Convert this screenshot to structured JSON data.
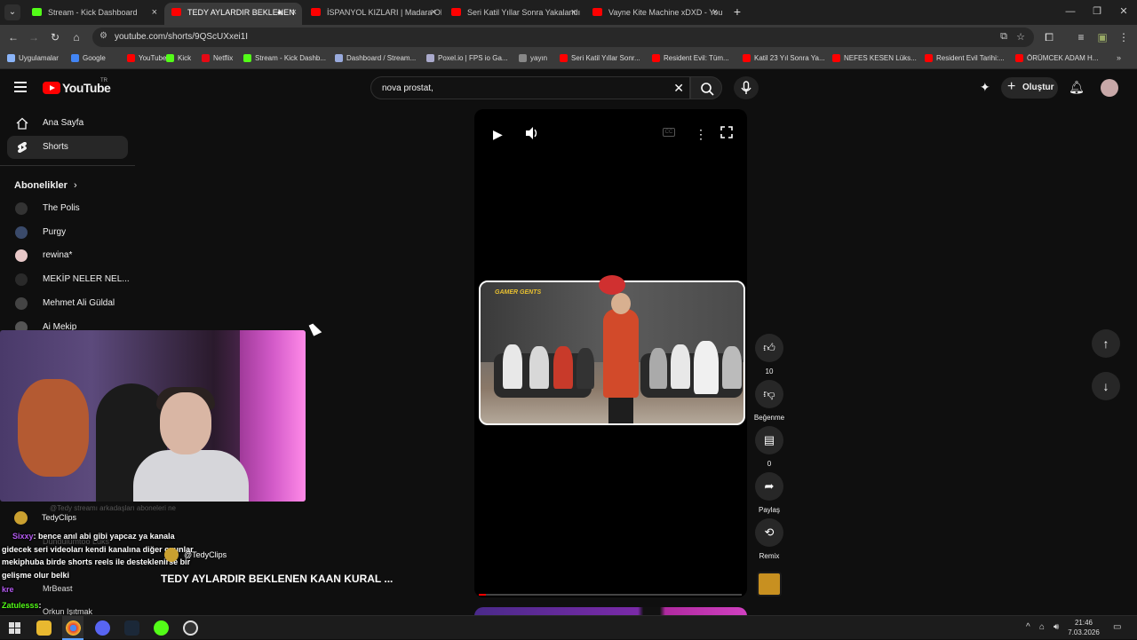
{
  "browser": {
    "tabs": [
      {
        "title": "Stream - Kick Dashboard",
        "active": false,
        "favicon_color": "#53fc18"
      },
      {
        "title": "TEDY AYLARDIR BEKLENEN",
        "active": true,
        "favicon_color": "#ff0000"
      },
      {
        "title": "İSPANYOL KIZLARI | Madara Ol",
        "active": false,
        "favicon_color": "#ff0000"
      },
      {
        "title": "Seri Katil Yıllar Sonra Yakalandı",
        "active": false,
        "favicon_color": "#ff0000"
      },
      {
        "title": "Vayne Kite Machine xDXD - You",
        "active": false,
        "favicon_color": "#ff0000"
      }
    ],
    "url": "youtube.com/shorts/9QScUXxei1I",
    "bookmarks": [
      {
        "label": "Uygulamalar",
        "color": "#8ab4f8"
      },
      {
        "label": "Google",
        "color": "#4285f4"
      },
      {
        "label": "YouTube",
        "color": "#ff0000"
      },
      {
        "label": "Kick",
        "color": "#53fc18"
      },
      {
        "label": "Netflix",
        "color": "#e50914"
      },
      {
        "label": "Stream - Kick Dashb...",
        "color": "#53fc18"
      },
      {
        "label": "Dashboard / Stream...",
        "color": "#9ad"
      },
      {
        "label": "Poxel.io | FPS io Ga...",
        "color": "#aac"
      },
      {
        "label": "yayın",
        "color": "#888"
      },
      {
        "label": "Seri Katil Yıllar Sonr...",
        "color": "#ff0000"
      },
      {
        "label": "Resident Evil: Tüm...",
        "color": "#ff0000"
      },
      {
        "label": "Katil 23 Yıl Sonra Ya...",
        "color": "#ff0000"
      },
      {
        "label": "NEFES KESEN Lüks...",
        "color": "#ff0000"
      },
      {
        "label": "Resident Evil Tarihi:...",
        "color": "#ff0000"
      },
      {
        "label": "ÖRÜMCEK ADAM H...",
        "color": "#ff0000"
      }
    ]
  },
  "youtube": {
    "logo_text": "YouTube",
    "country": "TR",
    "search_query": "nova prostat,",
    "create_label": "Oluştur",
    "sidebar": {
      "home": "Ana Sayfa",
      "shorts": "Shorts",
      "subscriptions_header": "Abonelikler",
      "subscriptions": [
        {
          "name": "The Polis",
          "color": "#333"
        },
        {
          "name": "Purgy",
          "color": "#3a4a6a"
        },
        {
          "name": "rewina*",
          "color": "#e8c8c8"
        },
        {
          "name": "MEKİP NELER NEL...",
          "color": "#2a2a2a"
        },
        {
          "name": "Mehmet Ali Güldal",
          "color": "#444"
        },
        {
          "name": "Ai Mekip",
          "color": "#555"
        }
      ]
    },
    "short": {
      "title": "TEDY AYLARDIR BEKLENEN KAAN KURAL ...",
      "channel": "@TedyClips",
      "video_logo": "GAMER GENTS",
      "likes": "10",
      "dislike_label": "Beğenme",
      "comments": "0",
      "share_label": "Paylaş",
      "remix_label": "Remix"
    }
  },
  "overlay_chat": {
    "lines": [
      {
        "user": "Sixxy",
        "text": ": bence anıl abi gibi yapcaz ya kanala",
        "color": "#b45af0"
      },
      {
        "user": "",
        "text": "gidecek seri videoları kendi kanalına diğer oyunlar",
        "color": "#fff"
      },
      {
        "user": "",
        "text": "mekiphuba birde shorts reels ile desteklenirse bir",
        "color": "#fff"
      },
      {
        "user": "",
        "text": "gelişme olur belki",
        "color": "#fff"
      },
      {
        "user": "Zatulesss",
        "text": ":",
        "color": "#53fc18"
      }
    ],
    "under_names": [
      {
        "name": "TedyClips"
      },
      {
        "name": "Dündülümtoo Lüks"
      },
      {
        "name": "MrBeast"
      },
      {
        "name": "Orkun Işıtmak"
      }
    ],
    "faded_text": "@Tedy streamı arkadaşları aboneleri ne",
    "partial_user": "kre"
  },
  "taskbar": {
    "time": "21:46",
    "date": "7.03.2026"
  }
}
